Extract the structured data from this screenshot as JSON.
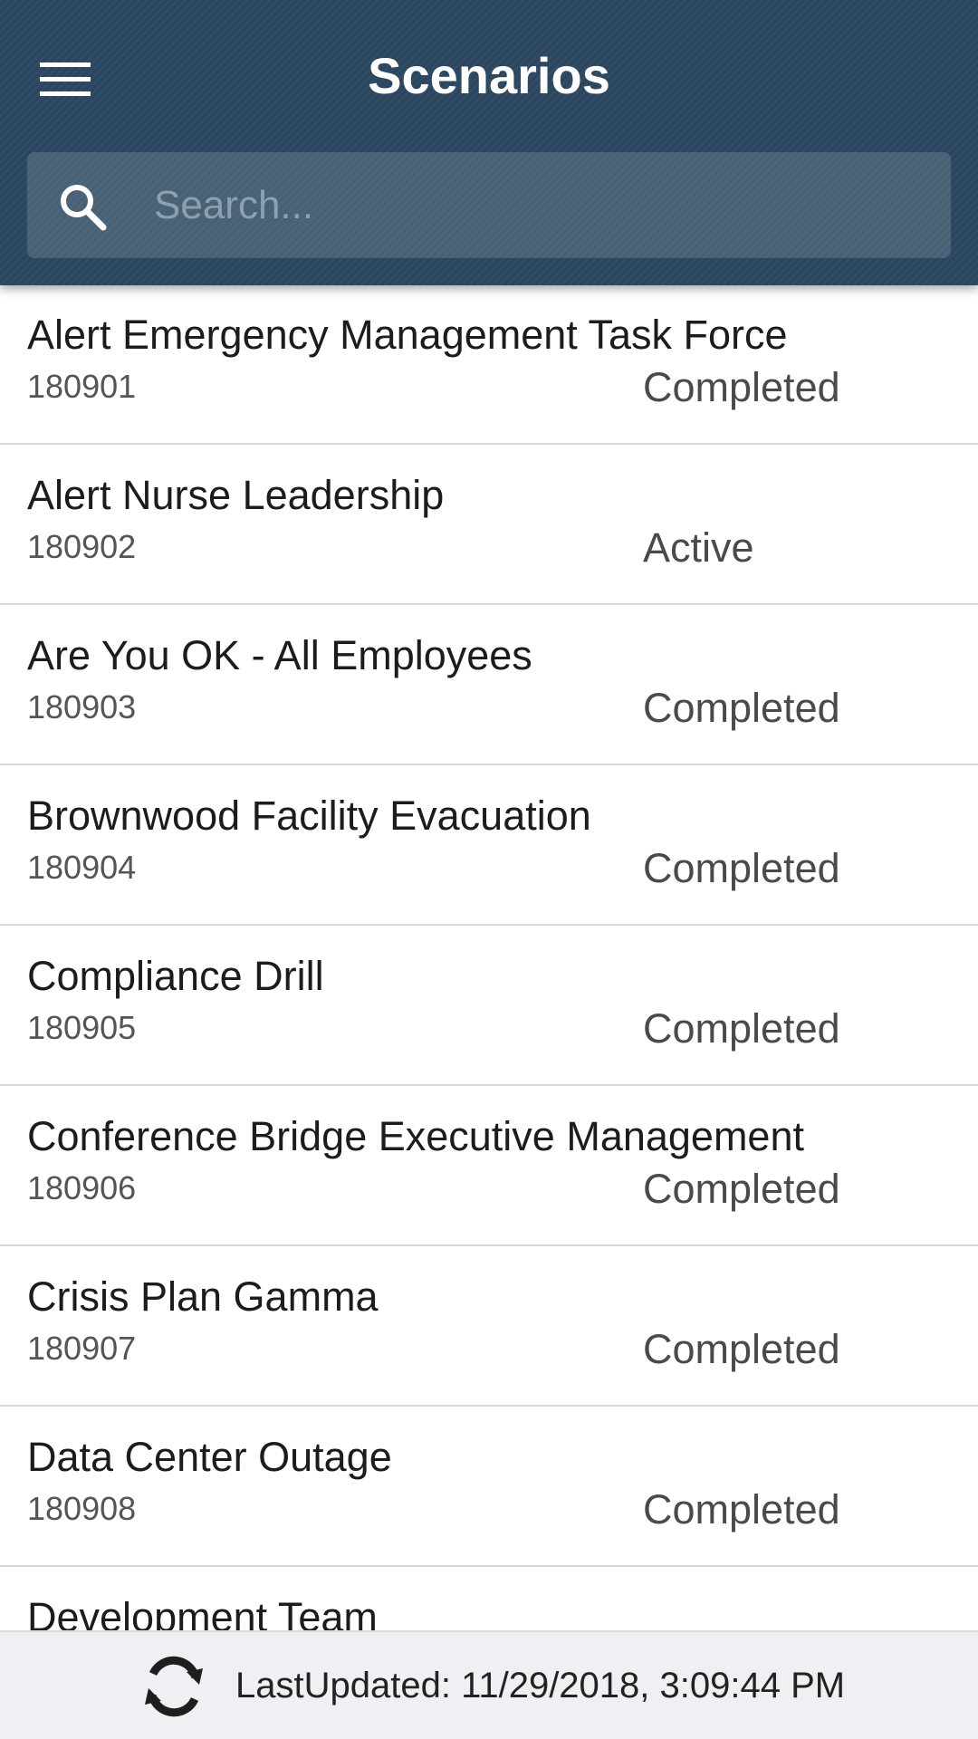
{
  "header": {
    "title": "Scenarios",
    "menu_icon": "hamburger-menu-icon",
    "search": {
      "placeholder": "Search...",
      "value": "",
      "icon": "search-icon"
    },
    "background_color": "#2b475f"
  },
  "scenarios": [
    {
      "title": "Alert Emergency Management Task Force",
      "id": "180901",
      "status": "Completed"
    },
    {
      "title": "Alert Nurse Leadership",
      "id": "180902",
      "status": "Active"
    },
    {
      "title": "Are You OK - All Employees",
      "id": "180903",
      "status": "Completed"
    },
    {
      "title": "Brownwood Facility Evacuation",
      "id": "180904",
      "status": "Completed"
    },
    {
      "title": "Compliance Drill",
      "id": "180905",
      "status": "Completed"
    },
    {
      "title": "Conference Bridge Executive Management",
      "id": "180906",
      "status": "Completed"
    },
    {
      "title": "Crisis Plan Gamma",
      "id": "180907",
      "status": "Completed"
    },
    {
      "title": "Data Center Outage",
      "id": "180908",
      "status": "Completed"
    },
    {
      "title": "Development Team",
      "id": "",
      "status": ""
    }
  ],
  "footer": {
    "refresh_icon": "refresh-icon",
    "last_updated": "LastUpdated: 11/29/2018, 3:09:44 PM"
  }
}
